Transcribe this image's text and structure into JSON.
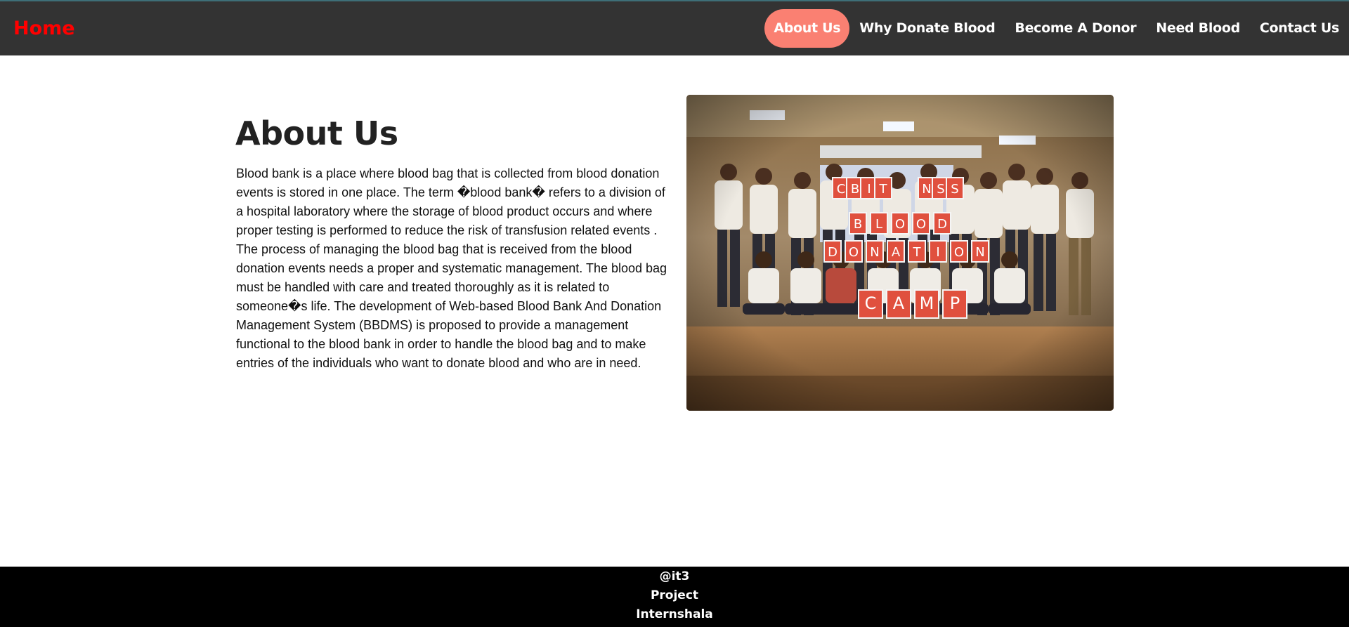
{
  "navbar": {
    "brand": "Home",
    "links": [
      {
        "label": "About Us",
        "active": true
      },
      {
        "label": "Why Donate Blood"
      },
      {
        "label": "Become A Donor"
      },
      {
        "label": "Need Blood"
      },
      {
        "label": "Contact Us"
      }
    ]
  },
  "about": {
    "title": "About Us",
    "body": "Blood bank is a place where blood bag that is collected from blood donation events is stored in one place. The term �blood bank� refers to a division of a hospital laboratory where the storage of blood product occurs and where proper testing is performed to reduce the risk of transfusion related events . The process of managing the blood bag that is received from the blood donation events needs a proper and systematic management. The blood bag must be handled with care and treated thoroughly as it is related to someone�s life. The development of Web-based Blood Bank And Donation Management System (BBDMS) is proposed to provide a management functional to the blood bank in order to handle the blood bag and to make entries of the individuals who want to donate blood and who are in need."
  },
  "photo": {
    "sign_letters": [
      "C",
      "B",
      "I",
      "T",
      "N",
      "S",
      "S",
      "B",
      "L",
      "O",
      "O",
      "D",
      "D",
      "O",
      "N",
      "A",
      "T",
      "I",
      "O",
      "N",
      "C",
      "A",
      "M",
      "P"
    ]
  },
  "footer": {
    "lines": [
      "@it3",
      "Project",
      "Internshala"
    ]
  },
  "colors": {
    "navbar_bg": "#333333",
    "brand": "#ff0000",
    "active_pill": "#fa8072",
    "footer_bg": "#000000"
  }
}
